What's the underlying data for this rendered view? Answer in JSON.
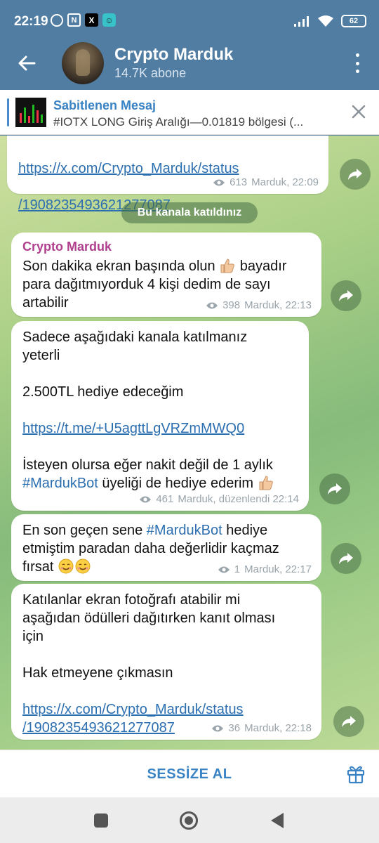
{
  "status_bar": {
    "time": "22:19",
    "battery": "62",
    "icons": [
      "alarm-icon",
      "nfc-icon",
      "x-app-icon",
      "bot-app-icon",
      "signal-icon",
      "wifi-icon",
      "battery-icon"
    ]
  },
  "header": {
    "title": "Crypto Marduk",
    "subtitle": "14.7K abone"
  },
  "pinned": {
    "title": "Sabitlenen Mesaj",
    "text": "#IOTX LONG Giriş Aralığı—0.01819 bölgesi (..."
  },
  "service": {
    "joined": "Bu kanala katıldınız"
  },
  "messages": [
    {
      "link1": "https://x.com/Crypto_Marduk/status",
      "link2": "/1908235493621277087",
      "views": "613",
      "meta": "Marduk, 22:09"
    },
    {
      "author": "Crypto Marduk",
      "text_a": "Son dakika ekran başında olun ",
      "text_b": " bayadır\npara dağıtmıyorduk 4 kişi dedim de sayı\nartabilir",
      "views": "398",
      "meta": "Marduk, 22:13"
    },
    {
      "text_a": "Sadece aşağıdaki kanala katılmanız\nyeterli\n\n2.500TL hediye edeceğim\n\n",
      "link": "https://t.me/+U5agttLgVRZmMWQ0",
      "text_b": "\n\nİsteyen olursa eğer nakit değil de 1 aylık\n",
      "tag": "#MardukBot",
      "text_c": " üyeliği de hediye ederim ",
      "views": "461",
      "meta": "Marduk, düzenlendi 22:14"
    },
    {
      "text_a": "En son geçen sene ",
      "tag": "#MardukBot",
      "text_b": " hediye\netmiştim paradan daha değerlidir kaçmaz\nfırsat ",
      "views": "1",
      "meta": "Marduk, 22:17"
    },
    {
      "text_a": "Katılanlar ekran fotoğrafı atabilir mi\naşağıdan ödülleri dağıtırken kanıt olması\niçin\n\nHak etmeyene çıkmasın\n\n",
      "link1": "https://x.com/Crypto_Marduk/status",
      "link2": "/1908235493621277087",
      "views": "36",
      "meta": "Marduk, 22:18"
    }
  ],
  "bottom": {
    "mute_label": "SESSİZE AL"
  },
  "colors": {
    "header_bg": "#517da2",
    "accent": "#3a83c4",
    "author": "#b0408e",
    "link": "#2c6fb0"
  }
}
